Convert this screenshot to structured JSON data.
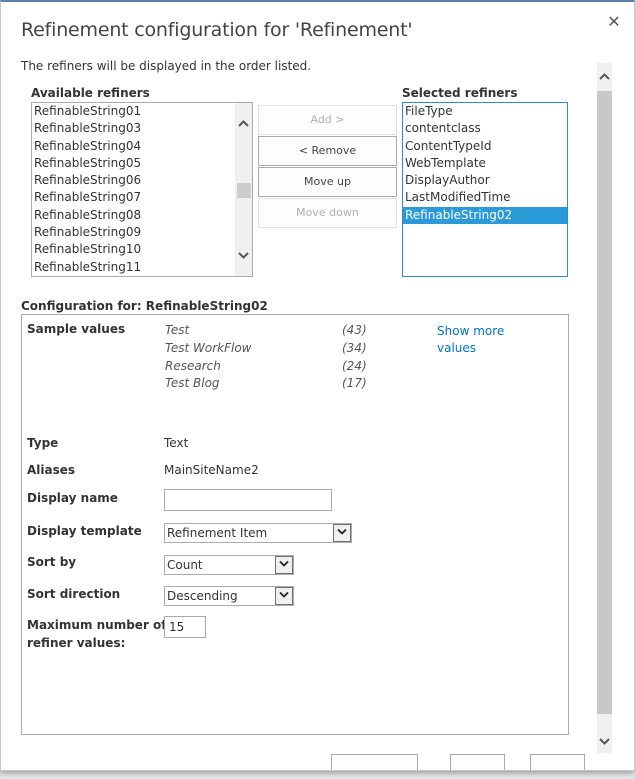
{
  "dialog": {
    "title": "Refinement configuration for 'Refinement'",
    "close_icon": "✕",
    "subtitle": "The refiners will be displayed in the order listed."
  },
  "available": {
    "label": "Available refiners",
    "items": [
      "RefinableString01",
      "RefinableString03",
      "RefinableString04",
      "RefinableString05",
      "RefinableString06",
      "RefinableString07",
      "RefinableString08",
      "RefinableString09",
      "RefinableString10",
      "RefinableString11"
    ]
  },
  "selected": {
    "label": "Selected refiners",
    "items": [
      "FileType",
      "contentclass",
      "ContentTypeId",
      "WebTemplate",
      "DisplayAuthor",
      "LastModifiedTime",
      "RefinableString02"
    ],
    "selected_index": 6
  },
  "buttons": {
    "add": "Add >",
    "remove": "< Remove",
    "move_up": "Move up",
    "move_down": "Move down"
  },
  "config": {
    "heading": "Configuration for: RefinableString02",
    "sample_values_label": "Sample values",
    "sample_values": [
      {
        "name": "Test",
        "count": "(43)"
      },
      {
        "name": "Test WorkFlow",
        "count": "(34)"
      },
      {
        "name": "Research",
        "count": "(24)"
      },
      {
        "name": "Test Blog",
        "count": "(17)"
      }
    ],
    "show_more": "Show more values",
    "type_label": "Type",
    "type_value": "Text",
    "aliases_label": "Aliases",
    "aliases_value": "MainSiteName2",
    "display_name_label": "Display name",
    "display_name_value": "",
    "display_template_label": "Display template",
    "display_template_value": "Refinement Item",
    "sort_by_label": "Sort by",
    "sort_by_value": "Count",
    "sort_direction_label": "Sort direction",
    "sort_direction_value": "Descending",
    "max_values_label_1": "Maximum number of",
    "max_values_label_2": "refiner values:",
    "max_values_value": "15"
  },
  "icons": {
    "chevron_up": "^",
    "chevron_down": "v",
    "dropdown": "⌄"
  }
}
